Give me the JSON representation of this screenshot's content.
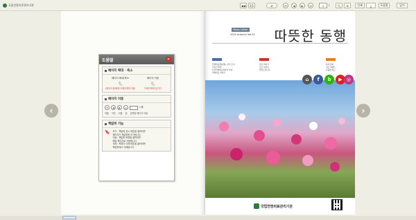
{
  "app": {
    "logo_text": "국립연명의료관리기관"
  },
  "toolbar": {
    "view_single": "◀◀",
    "view_double": "2|1",
    "page_current": "1",
    "page_separator": "/",
    "btn_print": "인쇄",
    "btn_help": "도움말",
    "btn_close": "닫기"
  },
  "help": {
    "title": "도움말",
    "close": "✕",
    "zoom_section": "페이지 확대 · 축소",
    "zoom_in_label": "페이지 확대/축소",
    "zoom_out_label": "페이지 이동",
    "zoom_in_desc": "(마우스휠)확대 \n 드래그하여 이동",
    "zoom_out_desc": "드래그하여 넘기기",
    "move_section": "페이지 이동",
    "move_labels": [
      "처음",
      "이전",
      "다음",
      "끝",
      "입력한 페이지 이동"
    ],
    "move_suffix": "/ 예",
    "keyword_section": "책갈피 기능",
    "keyword_lines": [
      "추가 : 책갈피 표시 버튼을 클릭하면",
      "페이지가 책갈피에 추가됩니다.",
      "이동 : 책갈피 목록을 클릭하면",
      "해당 페이지로 이동합니다.",
      "삭제 : 목록의 삭제 버튼을 클릭하면",
      "책갈피에서 삭제됩니다."
    ]
  },
  "cover": {
    "title": "따뜻한 동행",
    "newsletter": "News Letter",
    "issue": "2022 Autumn Vol.21",
    "org": "국립연명의료관리기관",
    "social": [
      "home-icon",
      "facebook-icon",
      "blog-icon",
      "youtube-icon",
      "instagram-icon"
    ],
    "toc_left": [
      "연명의료결정제도 관련 소식",
      "현장 인터뷰",
      "사전연명의료의향서 안내",
      "연명의료 이야기"
    ],
    "toc_mid": [
      "공감 이야기",
      "소식 한마당",
      "알려드립니다"
    ],
    "toc_right": [
      "독자 참여",
      "퀴즈 이벤트",
      "다음호 예고"
    ]
  },
  "colors": {
    "accent": "#2d7a3a",
    "close": "#cc3333",
    "toc_heads": [
      "#4a6fa5",
      "#c0392b",
      "#e67e22"
    ]
  }
}
